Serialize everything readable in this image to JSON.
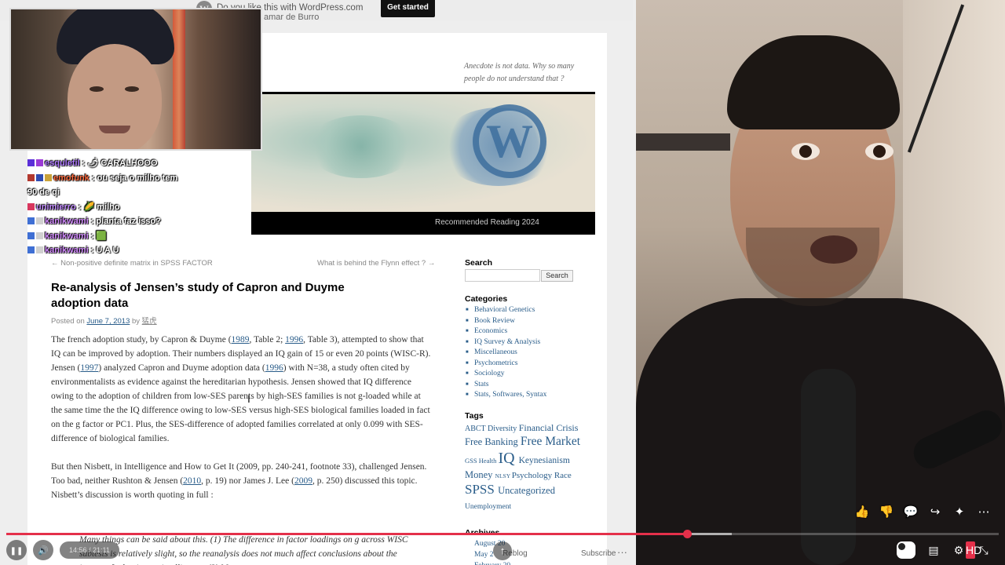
{
  "wp_bar": {
    "logo_glyph": "W",
    "text": "Do you like this with WordPress.com",
    "sub_text": "amar de Burro",
    "cta": "Get started"
  },
  "blog": {
    "tagline": "Anecdote is not data. Why so many people do not understand that ?",
    "banner_menu": "Recommended Reading 2024",
    "nav_prev": "← Non-positive definite matrix in SPSS FACTOR",
    "nav_next": "What is behind the Flynn effect ? →",
    "post_title": "Re-analysis of Jensen’s study of Capron and Duyme adoption data",
    "meta_prefix": "Posted on ",
    "meta_date": "June 7, 2013",
    "meta_by": " by ",
    "meta_author": "猛虎",
    "body": [
      [
        "The french adoption study, by Capron & Duyme (",
        {
          "link": "1989"
        },
        ", Table 2; ",
        {
          "link": "1996"
        },
        ", Table 3), attempted to show that IQ can be improved by adoption. Their numbers displayed an IQ gain of 15 or even 20 points (WISC-R). Jensen (",
        {
          "link": "1997"
        },
        ") analyzed Capron and Duyme adoption data (",
        {
          "link": "1996"
        },
        ") with N=38, a study often cited by environmentalists as evidence against the hereditarian hypothesis. Jensen showed that IQ difference owing to the adoption of children from low-SES parents by high-SES families is not g-loaded while at the same time the the IQ difference owing to low-SES versus high-SES biological families loaded in fact on the g factor or PC1. Plus, the SES-difference of adopted families correlated at only 0.099 with SES-difference of biological families."
      ],
      [
        "But then Nisbett, in Intelligence and How to Get It (2009, pp. 240-241, footnote 33), challenged Jensen. Too bad, neither Rushton & Jensen (",
        {
          "link": "2010"
        },
        ", p. 19) nor James J. Lee (",
        {
          "link": "2009"
        },
        ", p. 250) discussed this topic. Nisbett’s discussion is worth quoting in full :"
      ]
    ],
    "quote": "Many things can be said about this. (1) The difference in factor loadings on g across WISC subtests is relatively slight, so the reanalysis does not much affect conclusions about the impact of adoption on intelligence. (2) M",
    "footer_reblog": "Reblog",
    "footer_subscribe": "Subscribe",
    "footer_more": "···"
  },
  "sidebar": {
    "search_heading": "Search",
    "search_placeholder": "",
    "search_button": "Search",
    "categories_heading": "Categories",
    "categories": [
      "Behavioral Genetics",
      "Book Review",
      "Economics",
      "IQ Survey & Analysis",
      "Miscellaneous",
      "Psychometrics",
      "Sociology",
      "Stats",
      "Stats, Softwares, Syntax"
    ],
    "tags_heading": "Tags",
    "tags": [
      {
        "label": "ABCT",
        "size": 10
      },
      {
        "label": "Diversity",
        "size": 10
      },
      {
        "label": "Financial Crisis",
        "size": 12
      },
      {
        "label": "Free Banking",
        "size": 12.5
      },
      {
        "label": "Free Market",
        "size": 15.5
      },
      {
        "label": "GSS",
        "size": 8.5
      },
      {
        "label": "Health",
        "size": 8.5
      },
      {
        "label": "IQ",
        "size": 20
      },
      {
        "label": "Keynesianism",
        "size": 11.5
      },
      {
        "label": "Money",
        "size": 12.5
      },
      {
        "label": "NLSY",
        "size": 7.5
      },
      {
        "label": "Psychology",
        "size": 11
      },
      {
        "label": "Race",
        "size": 11
      },
      {
        "label": "SPSS",
        "size": 17
      },
      {
        "label": "Uncategorized",
        "size": 12.5
      },
      {
        "label": "Unemployment",
        "size": 9.5
      }
    ],
    "archives_heading": "Archives",
    "archives": [
      "August 20",
      "May 2",
      "February 20"
    ]
  },
  "chat": [
    {
      "user": "esquletil",
      "sep": " : ",
      "emote": "🌶",
      "msg": " CARALHOOO",
      "color_class": "u1",
      "badges": [
        "#5b2fd8",
        "#9c3bd6"
      ]
    },
    {
      "user": "emofunk",
      "sep": " : ",
      "emote": "",
      "msg": "ou seja o milho tem",
      "cont": "90 de qi",
      "color_class": "u2",
      "badges": [
        "#b2392f",
        "#2f4cb2",
        "#c9a23a"
      ]
    },
    {
      "user": "unimierro",
      "sep": " : ",
      "emote": "🌽",
      "msg": " milho",
      "color_class": "u3",
      "badges": [
        "#d8375e"
      ]
    },
    {
      "user": "kanikwami",
      "sep": " : ",
      "emote": "",
      "msg": "planta faz isso?",
      "color_class": "u4",
      "badges": [
        "#3f6fd4",
        "#d0d0d0"
      ]
    },
    {
      "user": "kanikwami",
      "sep": " : ",
      "emote": "🟩",
      "msg": "",
      "color_class": "u4",
      "badges": [
        "#3f6fd4",
        "#d0d0d0"
      ]
    },
    {
      "user": "kanikwami",
      "sep": " : ",
      "emote": "",
      "msg": "U A U",
      "color_class": "u4",
      "badges": [
        "#3f6fd4",
        "#d0d0d0"
      ]
    }
  ],
  "player": {
    "time": "14:56 / 21:11",
    "progress_played": 0.686,
    "pause_icon": "❚❚",
    "volume_icon": "🔊",
    "side_actions": [
      {
        "name": "like-icon",
        "glyph": "👍"
      },
      {
        "name": "dislike-icon",
        "glyph": "👎"
      },
      {
        "name": "comment-icon",
        "glyph": "💬"
      },
      {
        "name": "share-icon",
        "glyph": "↪"
      },
      {
        "name": "remix-icon",
        "glyph": "✦"
      },
      {
        "name": "more-icon",
        "glyph": "⋯"
      }
    ],
    "bottom_icons": [
      {
        "name": "captions-icon",
        "glyph": "▤"
      },
      {
        "name": "settings-icon",
        "glyph": "⚙"
      },
      {
        "name": "exit-fullscreen-icon",
        "glyph": "⤡"
      }
    ],
    "hd_badge": "HD",
    "accent": "#e4304a"
  }
}
